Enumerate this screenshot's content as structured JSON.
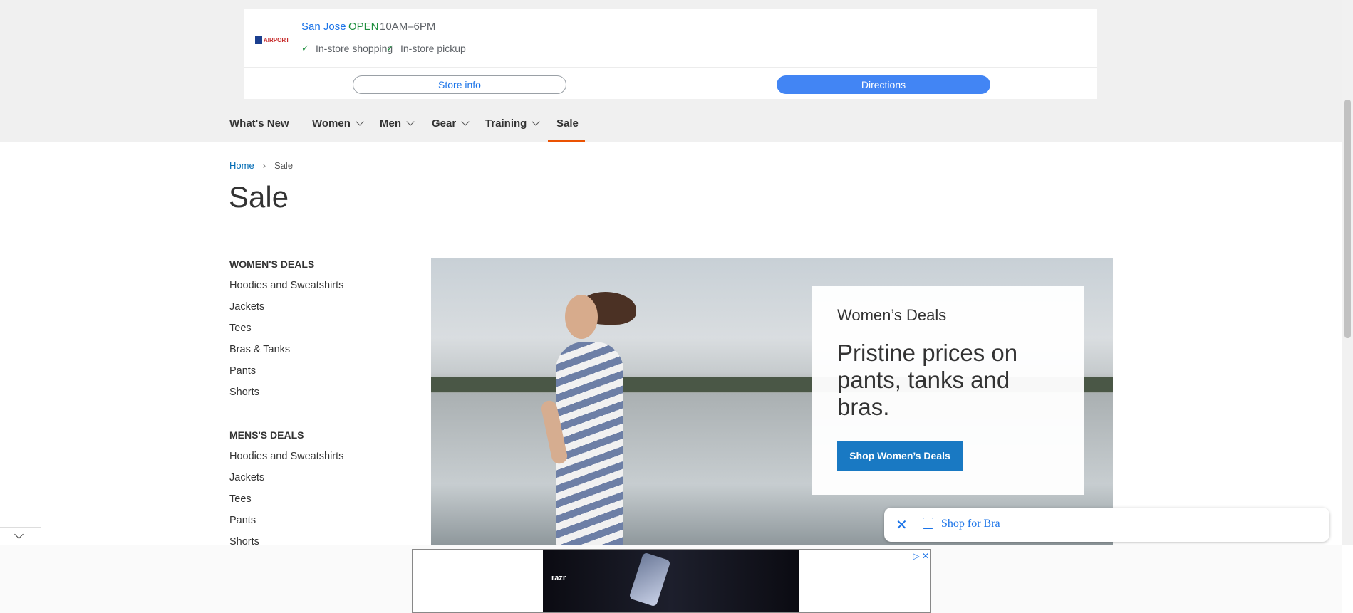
{
  "store": {
    "logo_text": "AIRPORT",
    "name": "San Jose",
    "status": "OPEN",
    "hours": "10AM–6PM",
    "features": [
      "In-store shopping",
      "In-store pickup"
    ],
    "store_info_label": "Store info",
    "directions_label": "Directions"
  },
  "nav": {
    "items": [
      "What's New",
      "Women",
      "Men",
      "Gear",
      "Training",
      "Sale"
    ]
  },
  "breadcrumb": {
    "home": "Home",
    "current": "Sale"
  },
  "page_title": "Sale",
  "sidebar": {
    "women_heading": "WOMEN'S DEALS",
    "women_links": [
      "Hoodies and Sweatshirts",
      "Jackets",
      "Tees",
      "Bras & Tanks",
      "Pants",
      "Shorts"
    ],
    "men_heading": "MENS'S DEALS",
    "men_links": [
      "Hoodies and Sweatshirts",
      "Jackets",
      "Tees",
      "Pants",
      "Shorts"
    ]
  },
  "promo": {
    "kicker": "Women’s Deals",
    "headline": "Pristine prices on pants, tanks and bras.",
    "button": "Shop Women’s Deals"
  },
  "shop_pill": {
    "text": "Shop for Bra"
  },
  "ad": {
    "brand": "razr"
  }
}
